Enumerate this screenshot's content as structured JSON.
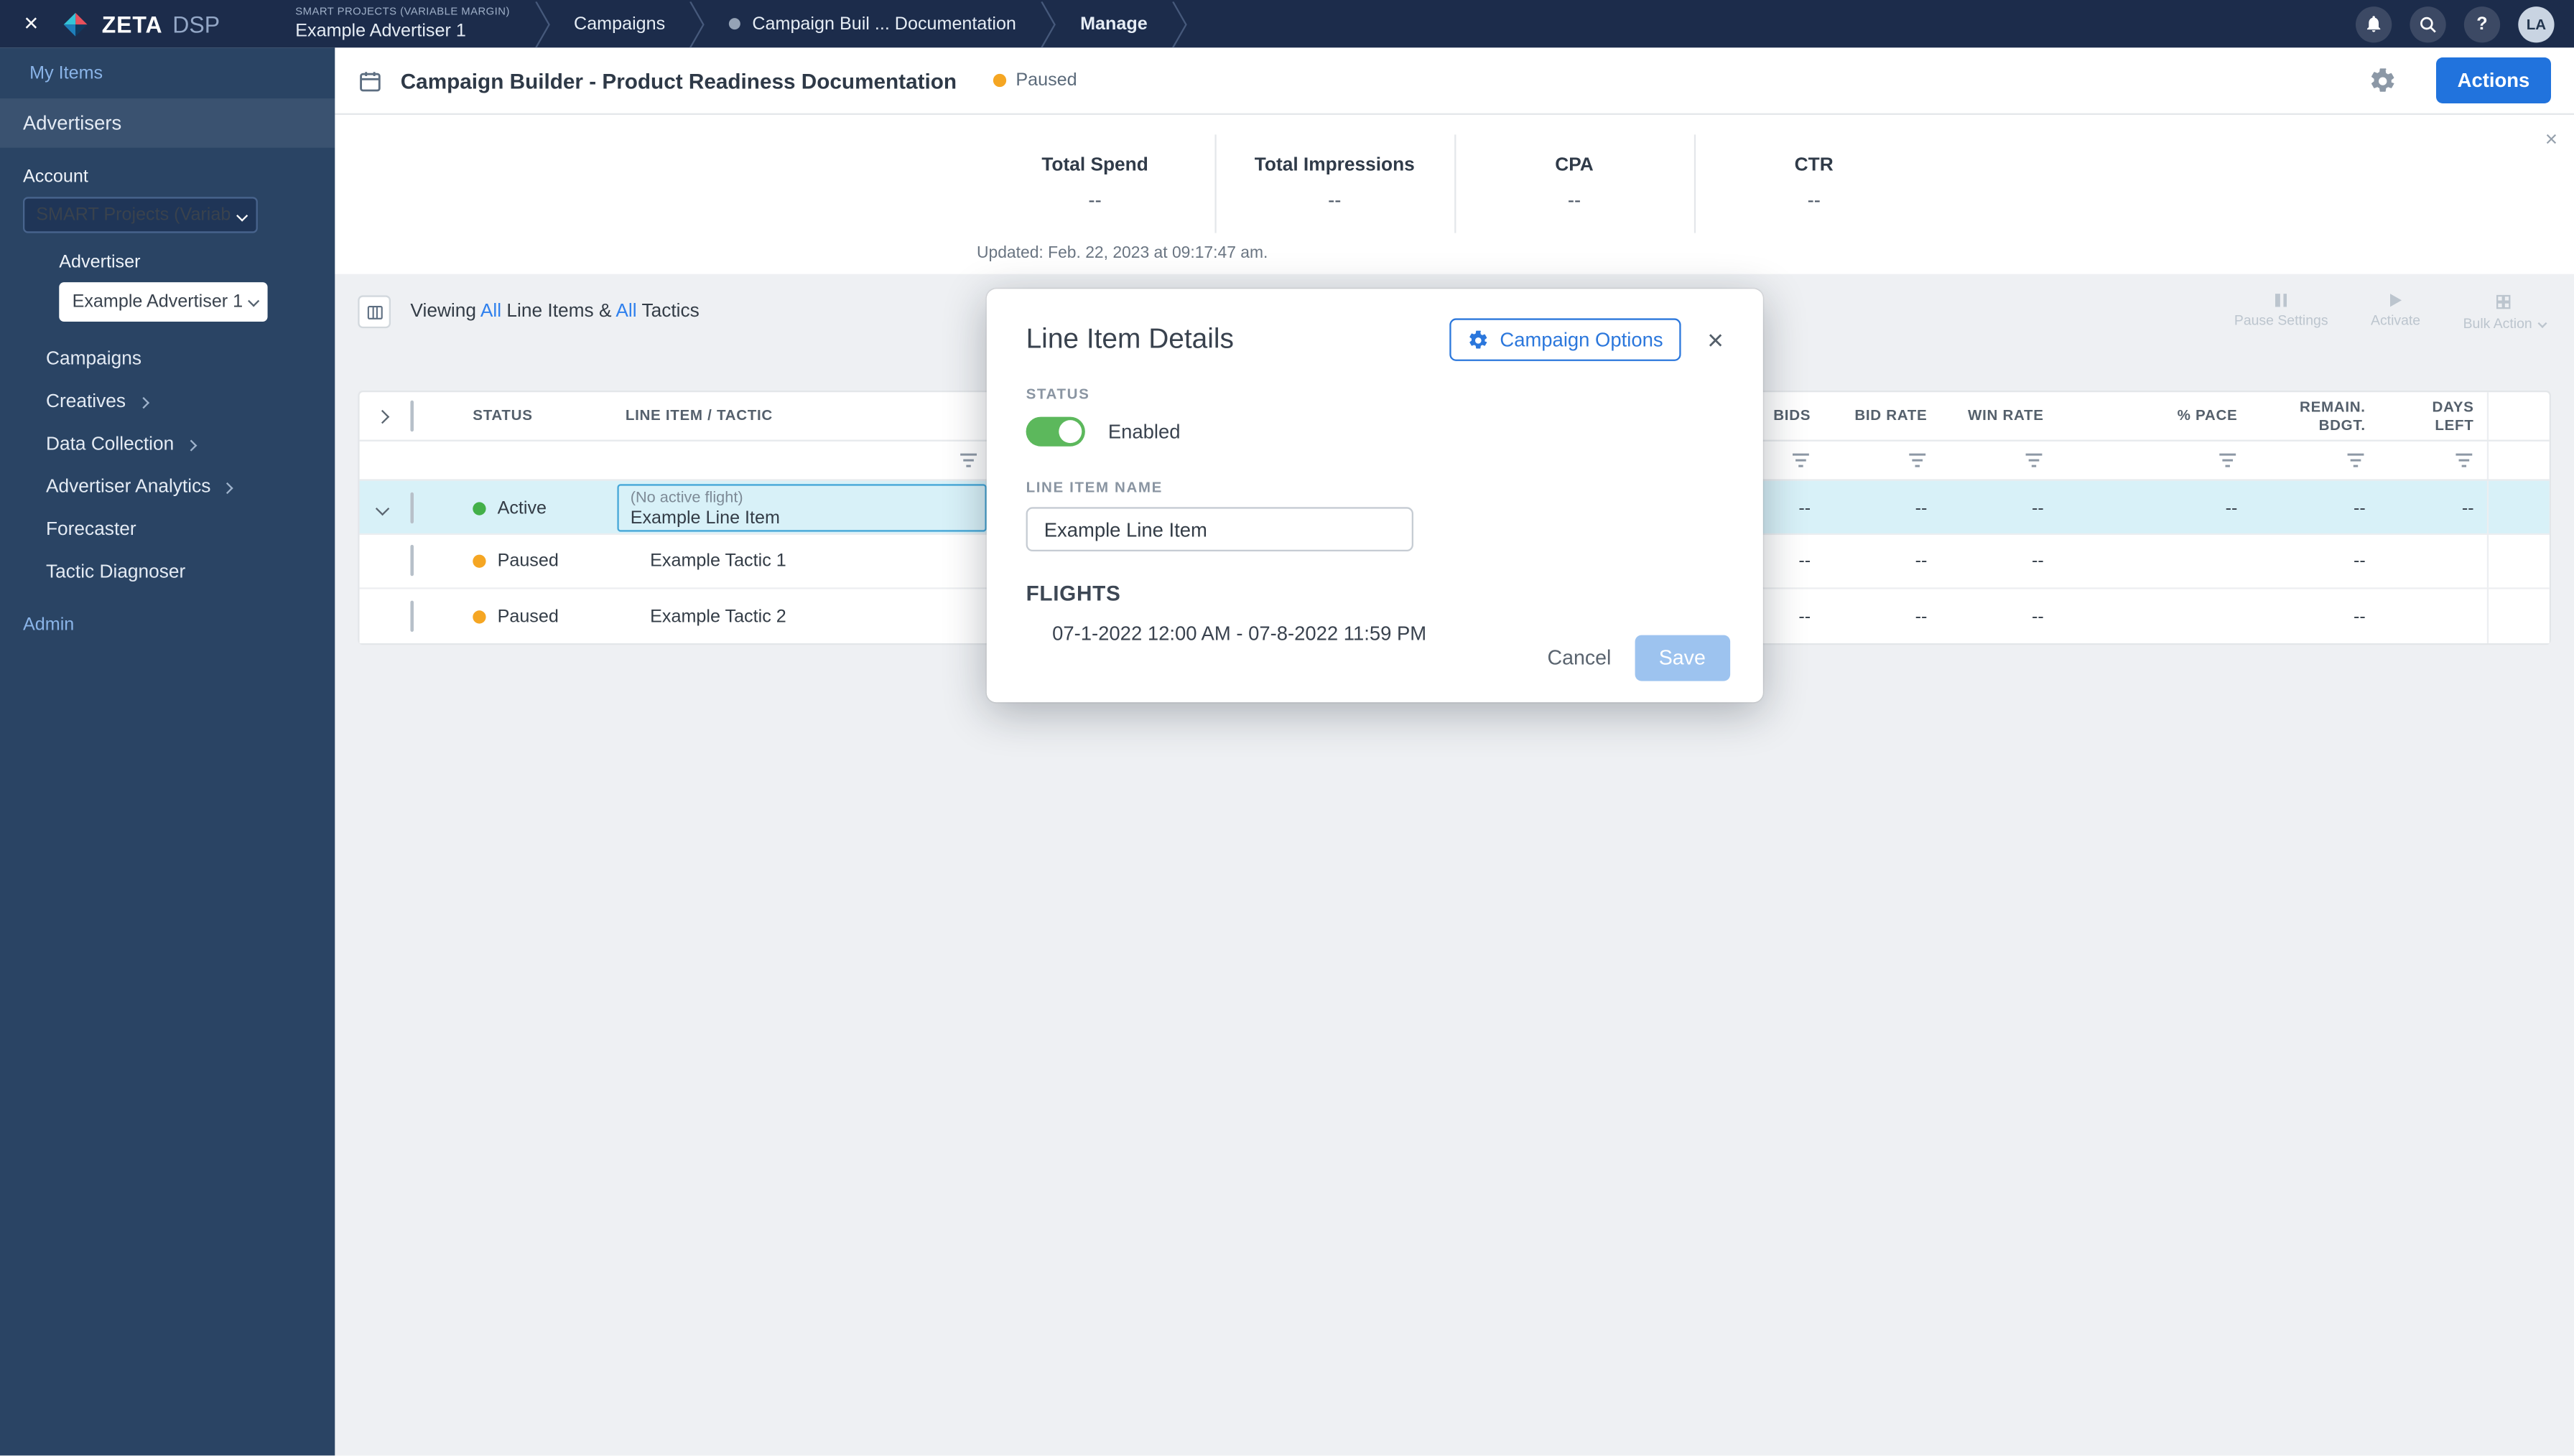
{
  "colors": {
    "accent_blue": "#2173dd",
    "link_blue": "#2f80ed",
    "status_active_green": "#43b049",
    "status_paused_orange": "#f5a623",
    "toggle_on_green": "#5cb85c",
    "selected_row_cyan": "#d8f1f8",
    "topbar_navy": "#1c2c4b",
    "sidebar_navy": "#2a4464"
  },
  "topbar": {
    "brand": "ZETA",
    "brand_suffix": "DSP",
    "crumb_account": "SMART PROJECTS (VARIABLE MARGIN)",
    "crumb_advertiser": "Example Advertiser 1",
    "crumb_campaigns": "Campaigns",
    "crumb_campaign": "Campaign Buil ... Documentation",
    "crumb_manage": "Manage",
    "help_label": "?",
    "avatar_initials": "LA"
  },
  "sidebar": {
    "my_items": "My Items",
    "advertisers": "Advertisers",
    "account_label": "Account",
    "account_value": "SMART Projects (Variable M...",
    "advertiser_label": "Advertiser",
    "advertiser_value": "Example Advertiser 1",
    "nav_campaigns": "Campaigns",
    "nav_creatives": "Creatives",
    "nav_data_collection": "Data Collection",
    "nav_advertiser_analytics": "Advertiser Analytics",
    "nav_forecaster": "Forecaster",
    "nav_tactic_diagnoser": "Tactic Diagnoser",
    "admin": "Admin"
  },
  "header": {
    "title": "Campaign Builder - Product Readiness Documentation",
    "status": "Paused",
    "actions_button": "Actions"
  },
  "stats": {
    "metrics": [
      {
        "label": "Total Spend",
        "value": "--"
      },
      {
        "label": "Total Impressions",
        "value": "--"
      },
      {
        "label": "CPA",
        "value": "--"
      },
      {
        "label": "CTR",
        "value": "--"
      }
    ],
    "updated": "Updated: Feb. 22, 2023 at 09:17:47 am."
  },
  "toolbar": {
    "viewing_prefix": "Viewing",
    "all_line_items": "All",
    "line_items_text": "Line Items &",
    "all_tactics": "All",
    "tactics_text": "Tactics",
    "pause_settings": "Pause Settings",
    "activate": "Activate",
    "bulk_action": "Bulk Action"
  },
  "table": {
    "headers": {
      "status": "STATUS",
      "line_item": "LINE ITEM / TACTIC",
      "bids": "BIDS",
      "bid_rate": "BID RATE",
      "win_rate": "WIN RATE",
      "pace": "% PACE",
      "remaining_budget": "REMAIN.\nBDGT.",
      "days_left": "DAYS\nLEFT"
    },
    "rows": [
      {
        "status": "Active",
        "flight_note": "(No active flight)",
        "name": "Example Line Item",
        "values": [
          "--",
          "--",
          "--",
          "--",
          "--",
          "--"
        ]
      },
      {
        "status": "Paused",
        "name": "Example Tactic 1",
        "values": [
          "--",
          "--",
          "--",
          "",
          "--",
          ""
        ]
      },
      {
        "status": "Paused",
        "name": "Example Tactic 2",
        "values": [
          "--",
          "--",
          "--",
          "",
          "--",
          ""
        ]
      }
    ]
  },
  "modal": {
    "title": "Line Item Details",
    "campaign_options": "Campaign Options",
    "status_label": "STATUS",
    "status_value": "Enabled",
    "name_label": "LINE ITEM NAME",
    "name_value": "Example Line Item",
    "flights_label": "FLIGHTS",
    "flight_range": "07-1-2022 12:00 AM - 07-8-2022 11:59 PM",
    "cancel": "Cancel",
    "save": "Save"
  }
}
